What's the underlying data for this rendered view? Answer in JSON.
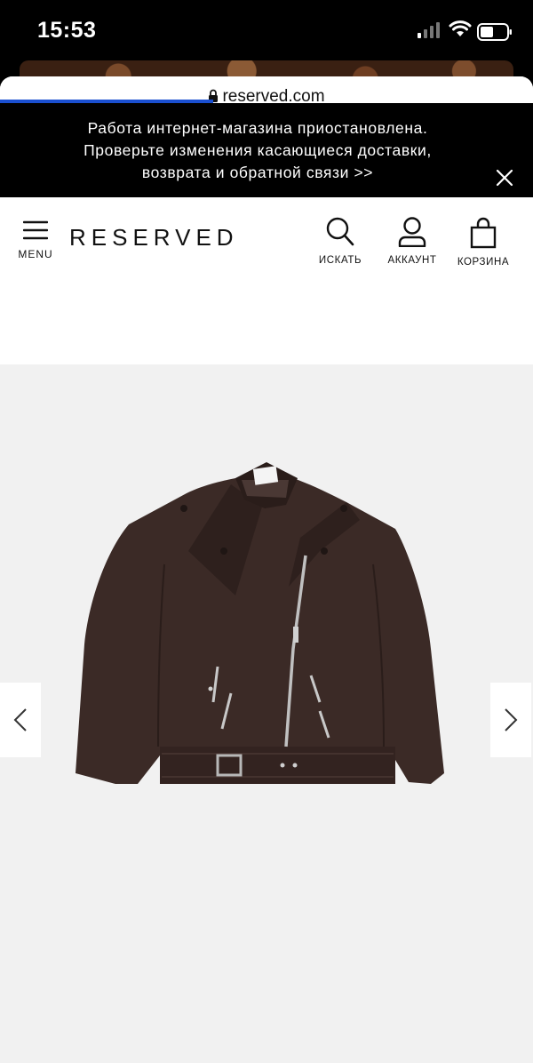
{
  "status_bar": {
    "time": "15:53"
  },
  "browser": {
    "url": "reserved.com"
  },
  "banner": {
    "line1": "Работа интернет-магазина приостановлена.",
    "line2": "Проверьте изменения касающиеся доставки,",
    "line3": "возврата и обратной связи >>"
  },
  "header": {
    "menu_label": "MENU",
    "logo": "RESERVED",
    "search_label": "ИСКАТЬ",
    "account_label": "АККАУНТ",
    "cart_label": "КОРЗИНА"
  },
  "colors": {
    "banner_bg": "#000000",
    "progress": "#1a4fd0",
    "gallery_bg": "#f1f1f1",
    "jacket": "#3b2a26"
  },
  "icons": {
    "menu": "hamburger-icon",
    "search": "search-icon",
    "account": "user-icon",
    "cart": "shopping-bag-icon",
    "close": "close-icon",
    "prev": "chevron-left-icon",
    "next": "chevron-right-icon"
  }
}
